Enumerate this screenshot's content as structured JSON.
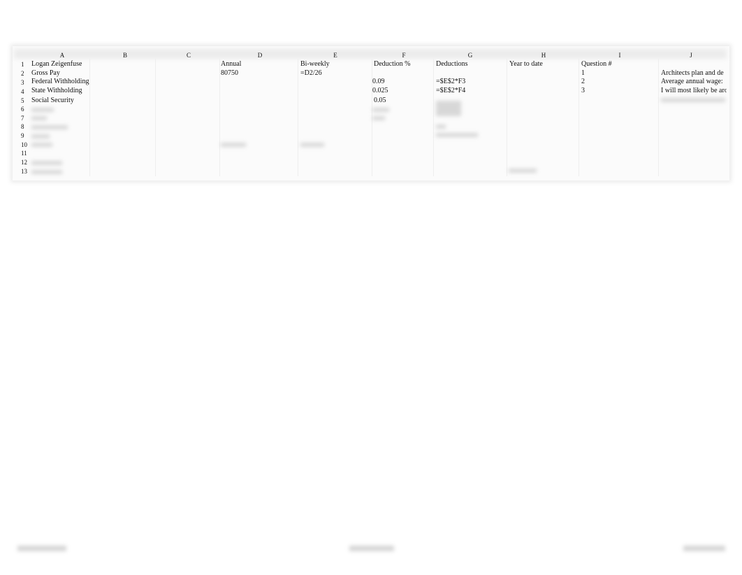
{
  "columns": [
    "A",
    "B",
    "C",
    "D",
    "E",
    "F",
    "G",
    "H",
    "I",
    "J"
  ],
  "row_numbers": [
    "1",
    "2",
    "3",
    "4",
    "5",
    "6",
    "7",
    "8",
    "9",
    "10",
    "11",
    "12",
    "13"
  ],
  "cells": {
    "A1": "Logan Zeigenfuse",
    "A2": "Gross Pay",
    "A3": "Federal Withholding",
    "A4": "State Withholding",
    "A5": "Social Security",
    "D1": "Annual",
    "D2": "80750",
    "E1": "Bi-weekly",
    "E2": "=D2/26",
    "F1": "Deduction %",
    "F3": "0.09",
    "F4": "0.025",
    "F5": "0.05",
    "G1": "Deductions",
    "G3": "=$E$2*F3",
    "G4": "=$E$2*F4",
    "H1": "Year to date",
    "I1": "Question #",
    "I2": "1",
    "I3": "2",
    "I4": "3",
    "J2": "Architects plan and de",
    "J3": "Average annual wage:",
    "J4": "I will most likely be aro"
  }
}
